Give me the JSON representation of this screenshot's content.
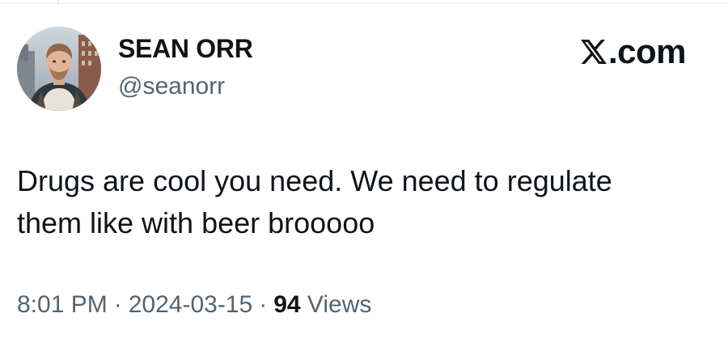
{
  "author": {
    "display_name": "SEAN ORR",
    "handle": "@seanorr"
  },
  "brand": {
    "label": ".com",
    "icon": "x-logo-icon"
  },
  "tweet": {
    "text_line_1": "Drugs are cool you need. We need to regulate",
    "text_line_2": "them like with beer brooooo"
  },
  "meta": {
    "time": "8:01 PM",
    "separator": "·",
    "date": "2024-03-15",
    "views_count": "94",
    "views_label": "Views"
  },
  "colors": {
    "text": "#0f1419",
    "secondary_text": "#536471",
    "background": "#ffffff"
  }
}
